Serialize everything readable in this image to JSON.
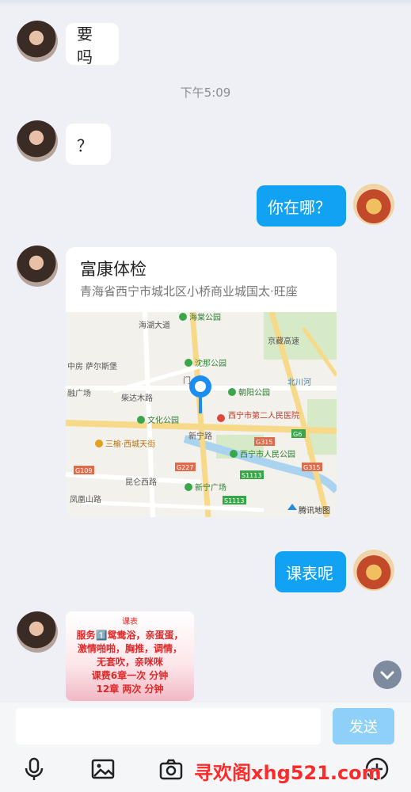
{
  "messages": [
    {
      "text": "要吗"
    },
    {
      "text": "？"
    },
    {
      "text": "你在哪？"
    },
    {
      "text": "课表呢"
    }
  ],
  "timestamp": "下午5:09",
  "location": {
    "title": "富康体检",
    "address": "青海省西宁市城北区小桥商业城国太·旺座",
    "map_labels": {
      "haitang": "海棠公园",
      "shena": "沈那公园",
      "chaoyang": "朝阳公园",
      "wenhua": "文化公园",
      "hospital2": "西宁市第二人民医院",
      "renmin": "西宁市人民公园",
      "sanyu": "三榆·西城天街",
      "xinning": "新宁广场",
      "kunlun": "昆仑西路",
      "chaidamu": "柴达木路",
      "fenghuang": "凤凰山路",
      "saersi": "萨尔斯堡",
      "haihu": "海湖大道",
      "xinning_road": "新宁路",
      "jingzang": "京藏高速",
      "huangshui": "北川河",
      "g315": "G315",
      "g109": "G109",
      "g227": "G227",
      "s1113": "S1113",
      "g6": "G6",
      "plaza": "融广场",
      "shop": "中房",
      "door": "门",
      "brand": "腾讯地图"
    }
  },
  "schedule": {
    "title": "课表",
    "lines": [
      "服务1️⃣鸳鸯浴，亲蛋蛋，",
      "激情啪啪，胸推，调情，",
      "无套吹，亲咪咪",
      "课费6章一次 分钟",
      "12章 两次 分钟"
    ]
  },
  "input": {
    "placeholder": "",
    "send_label": "发送"
  },
  "toolbar": {
    "icons": [
      "microphone-icon",
      "image-icon",
      "camera-icon",
      "plus-icon"
    ]
  },
  "watermark": "寻欢阁xhg521.com",
  "colors": {
    "my_bubble": "#12a2f3",
    "send_disabled": "#8fd0f8",
    "background": "#eef0f5"
  }
}
